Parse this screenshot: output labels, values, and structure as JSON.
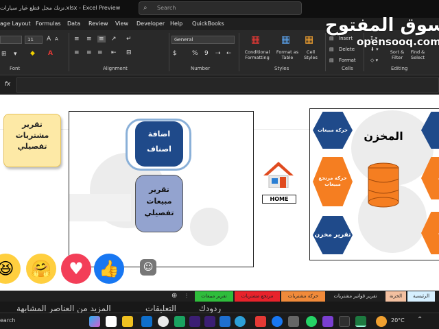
{
  "window": {
    "title": "نزنك مجل قطع غيار سيارات.xlsx - Excel Preview",
    "search_placeholder": "Search"
  },
  "menu": [
    "age Layout",
    "Formulas",
    "Data",
    "Review",
    "View",
    "Developer",
    "Help",
    "QuickBooks"
  ],
  "ribbon": {
    "font_size": "11",
    "number_format": "General",
    "groups": {
      "font": "Font",
      "alignment": "Alignment",
      "number": "Number",
      "styles": "Styles",
      "cells": "Cells",
      "editing": "Editing"
    },
    "styles_buttons": [
      "Conditional Formatting",
      "Format as Table",
      "Cell Styles"
    ],
    "cells_buttons": [
      "Insert",
      "Delete",
      "Format"
    ],
    "editing_buttons": [
      "Sort & Filter",
      "Find & Select"
    ]
  },
  "watermark": {
    "arabic": "السوق المفتوح",
    "latin": "opensooq.com"
  },
  "sheet": {
    "note": "تقرير مشتريات تفصيلي",
    "left_panel": {
      "add_items": "اضافة اصناف",
      "sales_report": "تقرير مبيعات تفصيلي"
    },
    "home_label": "HOME",
    "right_panel": {
      "title": "المخزن",
      "sales_movement": "حركة مبيعات",
      "sales_returns": "حركة مرتجع مبيعات",
      "stock_report": "تقرير مخزن",
      "cut_left_1": "ح",
      "cut_left_2": "كة",
      "cut_left_3": "كة"
    }
  },
  "tabs": [
    "الرئيسية",
    "الخزنة",
    "تقرير قواتير مشتريات",
    "حركة مشتريات",
    "مرتجع مشتريات",
    "تقرير مبيعات"
  ],
  "tab_colors": [
    "#d6f0ff",
    "#f3c0a0",
    "#e6e6e6",
    "#f08a3a",
    "#e8232b",
    "#2fbd3c"
  ],
  "caption": {
    "replies": "ردودك",
    "comments": "التعليقات",
    "more": "المزيد من العناصر المشابهة"
  },
  "taskbar": {
    "search": "earch",
    "temperature": "20°C"
  }
}
